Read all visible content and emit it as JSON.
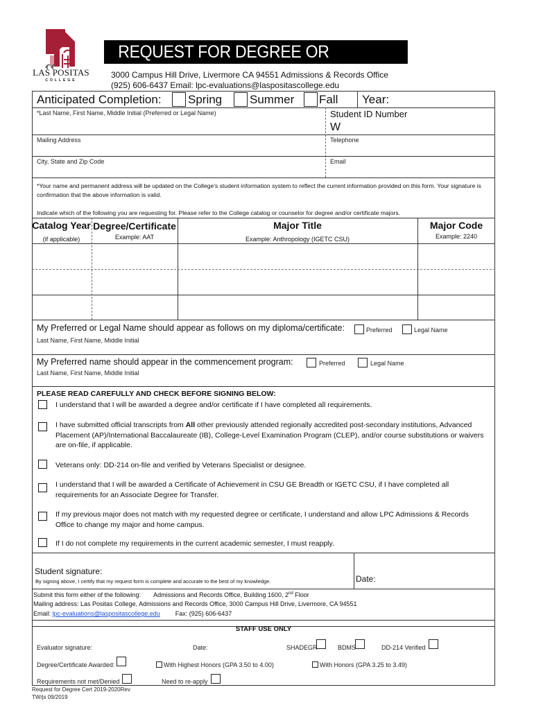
{
  "header": {
    "college_name": "LAS POSITAS",
    "college_sub": "COLLEGE",
    "title": "REQUEST FOR DEGREE OR CERTIFICATE",
    "address_line": "3000 Campus Hill Drive, Livermore CA 94551 Admissions & Records Office",
    "contact_line": "(925) 606-6437 Email: lpc-evaluations@laspositascollege.edu",
    "brand_color": "#a51f36"
  },
  "completion": {
    "label": "Anticipated Completion:",
    "options": [
      "Spring",
      "Summer",
      "Fall"
    ],
    "year_label": "Year:"
  },
  "student_info": {
    "name_label": "*Last Name, First Name, Middle Initial (Preferred or Legal Name)",
    "student_id_label": "Student ID Number",
    "student_id_prefix": "W",
    "mailing_label": "Mailing Address",
    "telephone_label": "Telephone",
    "city_label": "City, State and Zip Code",
    "email_label": "Email"
  },
  "notice": {
    "text": "*Your name and permanent address will be updated on the College's student information system to reflect the current information provided on this form.  Your signature is confirmation that the above information is valid.",
    "indicate": "Indicate which of the following you are requesting for.  Please refer to the College catalog or counselor for degree and/or certificate majors."
  },
  "request_table": {
    "columns": [
      {
        "header": "Catalog Year",
        "sub": "(if applicable)"
      },
      {
        "header": "Degree/Certificate",
        "sub": "Example: AAT"
      },
      {
        "header": "Major Title",
        "sub": "Example: Anthropology (IGETC CSU)"
      },
      {
        "header": "Major Code",
        "sub": "Example: 2240"
      }
    ],
    "rows": [
      [
        "",
        "",
        "",
        ""
      ],
      [
        "",
        "",
        "",
        ""
      ],
      [
        "",
        "",
        "",
        ""
      ]
    ]
  },
  "diploma_name": {
    "label": "My Preferred or Legal Name should appear as follows on my diploma/certificate:",
    "opt_preferred": "Preferred",
    "opt_legal": "Legal Name",
    "sub": "Last Name, First Name, Middle Initial"
  },
  "commencement_name": {
    "label": "My Preferred name should appear in the commencement program:",
    "opt_preferred": "Preferred",
    "opt_legal": "Legal Name",
    "sub": "Last Name, First Name, Middle Initial"
  },
  "acknowledgements": {
    "heading": "PLEASE READ CAREFULLY AND CHECK BEFORE SIGNING BELOW:",
    "items": [
      "I understand that I will be awarded a degree and/or certificate if I have completed all requirements.",
      "I have submitted official transcripts from All other previously attended regionally accredited post-secondary institutions,  Advanced Placement (AP)/International Baccalaureate (IB), College-Level Examination Program (CLEP), and/or course  substitutions or waivers are on-file, if applicable.",
      "Veterans only: DD-214 on-file and verified by Veterans Specialist or designee.",
      "I understand that I will be awarded a Certificate of Achievement in CSU GE Breadth or IGETC CSU, if I have completed all requirements for an Associate Degree for Transfer.",
      "If my previous major does not match with my requested degree or certificate, I understand and allow LPC Admissions &   Records Office to change my major and home campus.",
      "If I do not complete my requirements in the current academic semester, I must reapply."
    ],
    "item2_prefix": "I have submitted official transcripts from ",
    "item2_bold": "All",
    "item2_suffix": " other previously attended regionally accredited post-secondary institutions,  Advanced Placement (AP)/International Baccalaureate (IB), College-Level Examination Program (CLEP), and/or course  substitutions or waivers are on-file, if applicable."
  },
  "signature": {
    "label": "Student signature:",
    "certify": "By signing above, I certify that my request form is complete and accurate to the best of my knowledge.",
    "date_label": "Date:"
  },
  "submit": {
    "line1_prefix": "Submit this form either of the following:",
    "line1_location": "Admissions and Records Office, Building 1600, 2",
    "line1_sup": "nd",
    "line1_floor": " Floor",
    "line2": "Mailing address: Las Positas College, Admissions and Records Office, 3000 Campus Hill Drive, Livermore, CA 94551",
    "email_label": "Email: ",
    "email": "lpc-evaluations@laspositascollege.edu",
    "fax": "Fax: (925) 606-6437"
  },
  "staff": {
    "heading": "STAFF USE ONLY",
    "evaluator": "Evaluator signature:",
    "date": "Date:",
    "shadegr": "SHADEGR",
    "bdms": "BDMS",
    "dd214": "DD-214 Verified",
    "awarded": "Degree/Certificate Awarded:",
    "highest_honors": "With Highest Honors (GPA 3.50 to 4.00)",
    "honors": "With Honors (GPA 3.25 to 3.49)",
    "not_met": "Requirements not met/Denied",
    "reapply": "Need to re-apply"
  },
  "footer": {
    "line1": "Request for Degree Cert 2019-2020Rev",
    "line2": "TW/js 09/2019"
  }
}
